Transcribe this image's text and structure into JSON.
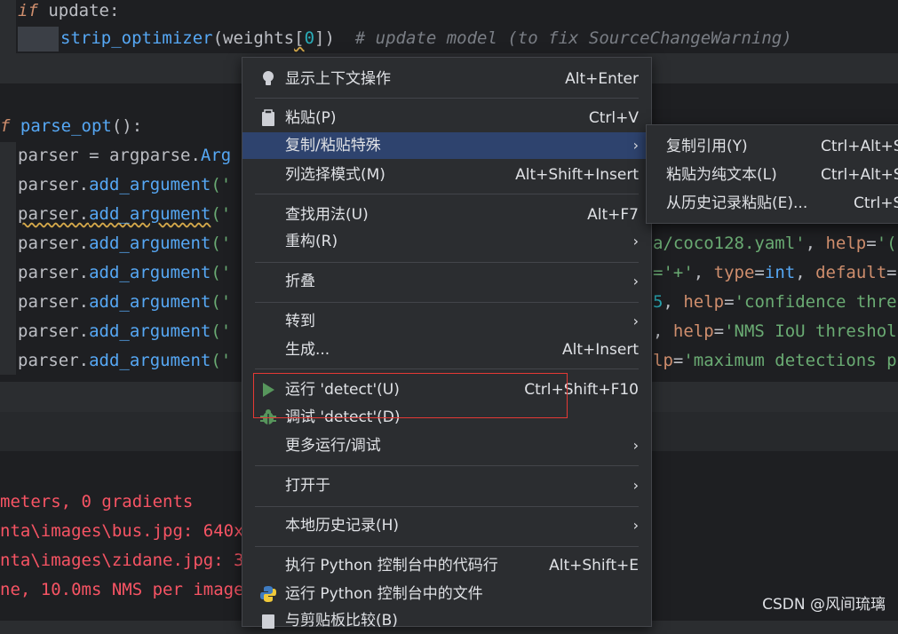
{
  "editor": {
    "lines": {
      "l1": {
        "kw": "if",
        "rest": " update:"
      },
      "l2": {
        "fn": "strip_optimizer",
        "a": "(weights",
        "b": "[",
        "c": "0",
        "d": "])",
        "cm": "  # update model (to fix SourceChangeWarning)"
      },
      "l3": {
        "kw": "f",
        "fn": "parse_opt",
        "rest": "():"
      },
      "l4": {
        "a": "parser = argparse.",
        "b": "Arg"
      },
      "l5": {
        "a": "parser.",
        "b": "add_argument",
        "c": "('"
      },
      "right": {
        "r1": {
          "a": "a/coco128.yaml'",
          "b": ", ",
          "c": "help",
          "d": "=",
          "e": "'("
        },
        "r2": {
          "a": "='+'",
          "b": ", ",
          "c": "type",
          "d": "=",
          "e": "int",
          "f": ", ",
          "g": "default",
          "h": "="
        },
        "r3": {
          "a": "5",
          "b": ", ",
          "c": "help",
          "d": "=",
          "e": "'confidence thre"
        },
        "r4": {
          "a": ", ",
          "c": "help",
          "d": "=",
          "e": "'NMS IoU threshol"
        },
        "r5": {
          "c": "lp",
          "d": "=",
          "e": "'maximum detections p"
        }
      }
    }
  },
  "console": {
    "lines": [
      "meters, 0 gradients",
      "nta\\images\\bus.jpg: 640x",
      "nta\\images\\zidane.jpg: 3",
      "ne, 10.0ms NMS per image"
    ]
  },
  "menu": {
    "items": [
      {
        "label": "显示上下文操作",
        "shortcut": "Alt+Enter",
        "icon": "lightbulb-icon"
      },
      {
        "label": "粘贴(P)",
        "shortcut": "Ctrl+V",
        "icon": "clipboard-icon"
      },
      {
        "label": "复制/粘贴特殊",
        "arrow": "›"
      },
      {
        "label": "列选择模式(M)",
        "shortcut": "Alt+Shift+Insert"
      },
      {
        "label": "查找用法(U)",
        "shortcut": "Alt+F7"
      },
      {
        "label": "重构(R)",
        "arrow": "›"
      },
      {
        "label": "折叠",
        "arrow": "›"
      },
      {
        "label": "转到",
        "arrow": "›"
      },
      {
        "label": "生成...",
        "shortcut": "Alt+Insert"
      },
      {
        "label": "运行 'detect'(U)",
        "shortcut": "Ctrl+Shift+F10",
        "icon": "run-icon"
      },
      {
        "label": "调试 'detect'(D)",
        "icon": "debug-icon"
      },
      {
        "label": "更多运行/调试",
        "arrow": "›"
      },
      {
        "label": "打开于",
        "arrow": "›"
      },
      {
        "label": "本地历史记录(H)",
        "arrow": "›"
      },
      {
        "label": "执行 Python 控制台中的代码行",
        "shortcut": "Alt+Shift+E"
      },
      {
        "label": "运行 Python 控制台中的文件",
        "icon": "python-icon"
      },
      {
        "label": "与剪贴板比较(B)",
        "icon": "compare-icon"
      }
    ]
  },
  "submenu": {
    "items": [
      {
        "label": "复制引用(Y)",
        "shortcut": "Ctrl+Alt+S"
      },
      {
        "label": "粘贴为纯文本(L)",
        "shortcut": "Ctrl+Alt+S"
      },
      {
        "label": "从历史记录粘贴(E)...",
        "shortcut": "Ctrl+S"
      }
    ]
  },
  "watermark": "CSDN @风间琉璃"
}
